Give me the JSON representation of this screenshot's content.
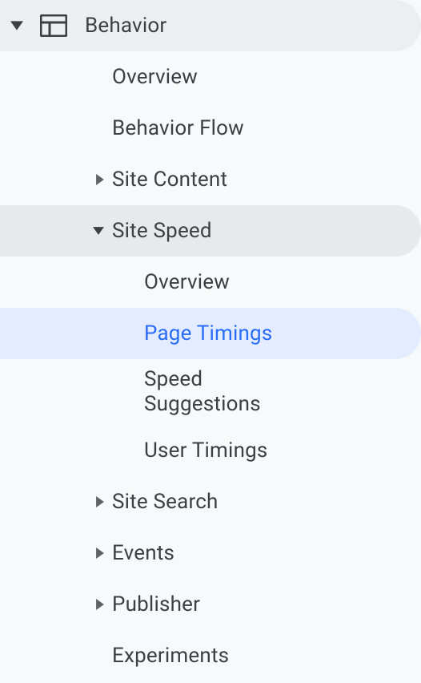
{
  "section": {
    "label": "Behavior"
  },
  "items": {
    "overview": "Overview",
    "behavior_flow": "Behavior Flow",
    "site_content": "Site Content",
    "site_speed": "Site Speed",
    "site_search": "Site Search",
    "events": "Events",
    "publisher": "Publisher",
    "experiments": "Experiments"
  },
  "site_speed_children": {
    "overview": "Overview",
    "page_timings": "Page Timings",
    "speed_suggestions": "Speed\nSuggestions",
    "user_timings": "User Timings"
  }
}
